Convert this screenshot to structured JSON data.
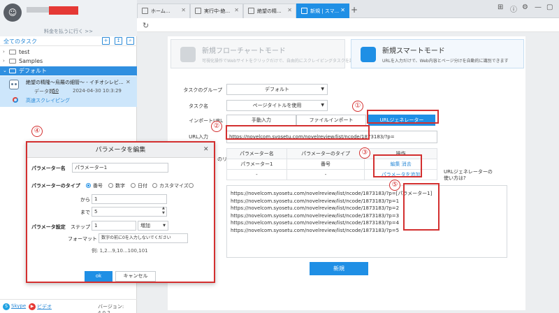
{
  "sidebar": {
    "upgrade_link": "料金を払うに行く >>",
    "all_tasks": "全てのタスク",
    "tree": [
      {
        "caret": "›",
        "label": "test"
      },
      {
        "caret": "›",
        "label": "Samples"
      },
      {
        "caret": "⌄",
        "label": "デフォルト"
      }
    ],
    "task": {
      "title": "絶望の精隆～烏羅の細管～ - イチオシレビ...",
      "data_label": "データ数:",
      "data_count": "50",
      "date": "2024-04-30 10:3:29",
      "status": "高速スクレイピング"
    },
    "footer": {
      "skype": "Skype",
      "video": "ビデオ",
      "version": "バージョン: 4.0.2"
    }
  },
  "tabs": [
    {
      "label": "ホーム..."
    },
    {
      "label": "実行中-絶..."
    },
    {
      "label": "絶望の精..."
    },
    {
      "label": "新規 | スマ..."
    }
  ],
  "modes": {
    "flow": {
      "title": "新規フローチャートモード",
      "desc": "可視化操作でWebサイトをクリックだけで、自由的にスクレイピングタスクを設定"
    },
    "smart": {
      "title": "新規スマートモード",
      "desc": "URLを入力だけで、Web内容とページ分けを自動的に識別できます"
    }
  },
  "form": {
    "group_label": "タスクのグループ",
    "group_value": "デフォルト",
    "name_label": "タスク名",
    "name_value": "ページタイトルを使用",
    "import_label": "インポートURL",
    "import_options": [
      "手動入力",
      "ファイルインポート",
      "URLジェネレーター"
    ],
    "url_label": "URL入力",
    "url_value": "https://novelcom.syosetu.com/novelreview/list/ncode/1873183/?p=",
    "param_partial_label": "のリ",
    "param_table": {
      "headers": [
        "パラメーター名",
        "パラメーターのタイプ",
        "操作"
      ],
      "row": [
        "パラメーター1",
        "番号"
      ],
      "edit": "編集",
      "delete": "消去",
      "empty_row": [
        "-",
        "-"
      ],
      "add": "パラメータを追加"
    },
    "help_link": "URLジェネレーターの使い方は?",
    "preview": [
      "https://novelcom.syosetu.com/novelreview/list/ncode/1873183/?p=[パラメーター1]",
      "https://novelcom.syosetu.com/novelreview/list/ncode/1873183/?p=1",
      "https://novelcom.syosetu.com/novelreview/list/ncode/1873183/?p=2",
      "https://novelcom.syosetu.com/novelreview/list/ncode/1873183/?p=3",
      "https://novelcom.syosetu.com/novelreview/list/ncode/1873183/?p=4",
      "https://novelcom.syosetu.com/novelreview/list/ncode/1873183/?p=5"
    ],
    "create_button": "新規"
  },
  "annotations": [
    "①",
    "②",
    "③",
    "④",
    "⑤"
  ],
  "dialog": {
    "title": "パラメータを編集",
    "name_label": "パラメーター名",
    "name_value": "パラメーター1",
    "type_label": "パラメーターのタイプ",
    "types": [
      "番号",
      "数字",
      "日付",
      "カスタマイズ"
    ],
    "from_label": "から",
    "from_value": "1",
    "to_label": "まで",
    "to_value": "5",
    "settings_label": "パラメータ設定",
    "step_label": "ステップ",
    "step_value": "1",
    "step_mode": "増加",
    "format_label": "フォーマット",
    "format_value": "数字の前に0を入力しないでください",
    "example": "例: 1,2...9,10...100,101",
    "ok": "ok",
    "cancel": "キャンセル"
  },
  "colors": {
    "accent": "#1f8fe5",
    "annotation": "#d32f2f"
  }
}
